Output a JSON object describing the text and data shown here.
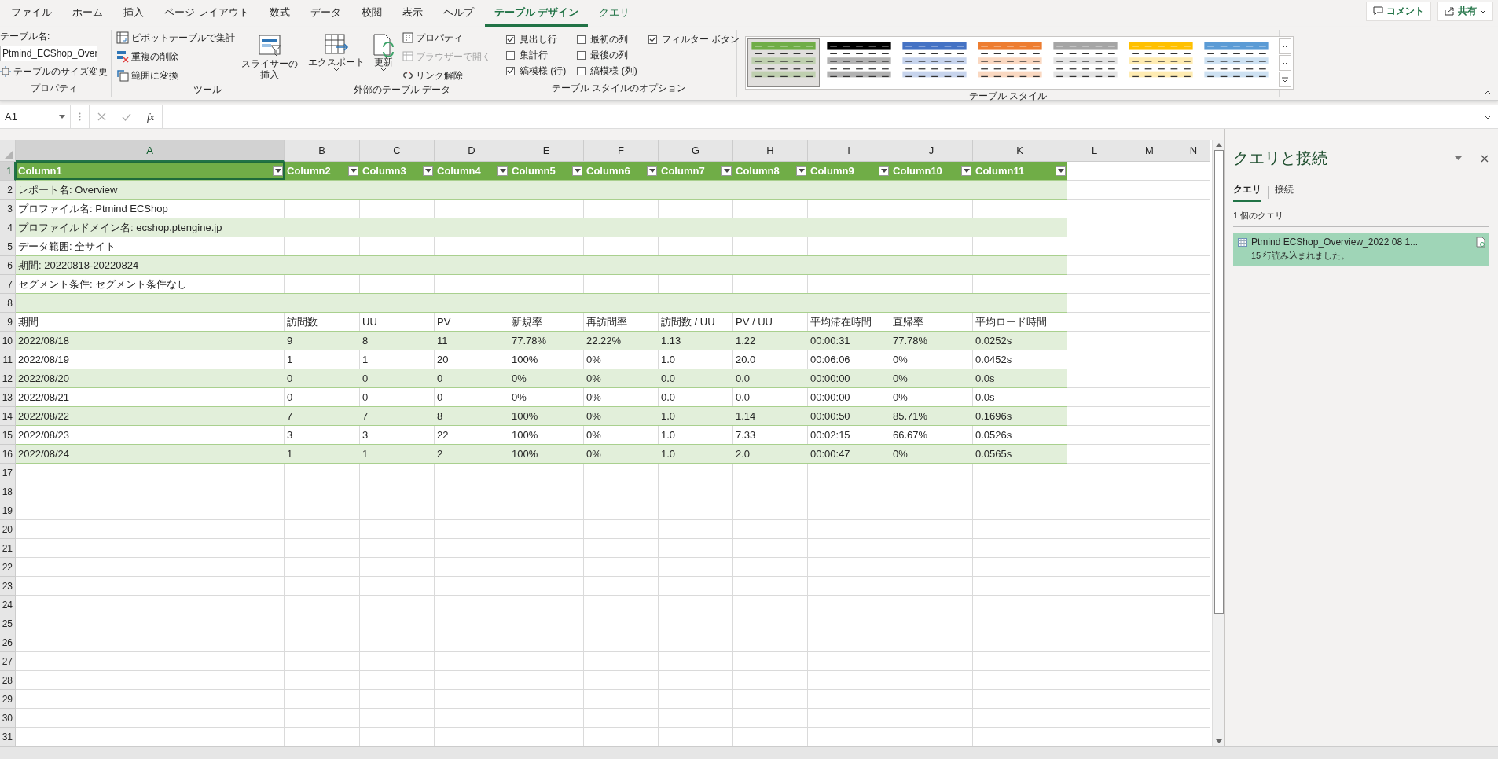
{
  "menu_tabs": [
    {
      "label": "ファイル",
      "selected": false,
      "contextual": false
    },
    {
      "label": "ホーム",
      "selected": false,
      "contextual": false
    },
    {
      "label": "挿入",
      "selected": false,
      "contextual": false
    },
    {
      "label": "ページ レイアウト",
      "selected": false,
      "contextual": false
    },
    {
      "label": "数式",
      "selected": false,
      "contextual": false
    },
    {
      "label": "データ",
      "selected": false,
      "contextual": false
    },
    {
      "label": "校閲",
      "selected": false,
      "contextual": false
    },
    {
      "label": "表示",
      "selected": false,
      "contextual": false
    },
    {
      "label": "ヘルプ",
      "selected": false,
      "contextual": false
    },
    {
      "label": "テーブル デザイン",
      "selected": true,
      "contextual": true
    },
    {
      "label": "クエリ",
      "selected": false,
      "contextual": true
    }
  ],
  "top_buttons": {
    "comment": "コメント",
    "share": "共有"
  },
  "ribbon": {
    "properties": {
      "label": "テーブル名:",
      "table_name": "Ptmind_ECShop_Over",
      "resize": "テーブルのサイズ変更",
      "group": "プロパティ"
    },
    "tools": {
      "pivot": "ピボットテーブルで集計",
      "remove_duplicates": "重複の削除",
      "convert": "範囲に変換",
      "slicer": [
        "スライサーの",
        "挿入"
      ],
      "group": "ツール"
    },
    "external": {
      "export": "エクスポート",
      "refresh": "更新",
      "properties": "プロパティ",
      "open_browser": "ブラウザーで開く",
      "open_browser_disabled": true,
      "unlink": "リンク解除",
      "group": "外部のテーブル データ"
    },
    "style_options": {
      "group": "テーブル スタイルのオプション",
      "checkboxes": [
        {
          "label": "見出し行",
          "checked": true
        },
        {
          "label": "集計行",
          "checked": false
        },
        {
          "label": "縞模様 (行)",
          "checked": true
        },
        {
          "label": "最初の列",
          "checked": false
        },
        {
          "label": "最後の列",
          "checked": false
        },
        {
          "label": "縞模様 (列)",
          "checked": false
        },
        {
          "label": "フィルター ボタン",
          "checked": true
        }
      ]
    },
    "table_styles": {
      "group": "テーブル スタイル",
      "styles": [
        {
          "color": "#70ad47",
          "selected": true
        },
        {
          "color": "#000000",
          "selected": false
        },
        {
          "color": "#4472c4",
          "selected": false
        },
        {
          "color": "#ed7d31",
          "selected": false
        },
        {
          "color": "#a5a5a5",
          "selected": false
        },
        {
          "color": "#ffc000",
          "selected": false
        },
        {
          "color": "#5b9bd5",
          "selected": false
        }
      ]
    }
  },
  "formula_bar": {
    "name_box": "A1",
    "function_button": "fx"
  },
  "grid": {
    "columns": [
      {
        "label": "A",
        "selected": true
      },
      {
        "label": "B",
        "selected": false
      },
      {
        "label": "C",
        "selected": false
      },
      {
        "label": "D",
        "selected": false
      },
      {
        "label": "E",
        "selected": false
      },
      {
        "label": "F",
        "selected": false
      },
      {
        "label": "G",
        "selected": false
      },
      {
        "label": "H",
        "selected": false
      },
      {
        "label": "I",
        "selected": false
      },
      {
        "label": "J",
        "selected": false
      },
      {
        "label": "K",
        "selected": false
      },
      {
        "label": "L",
        "selected": false
      },
      {
        "label": "M",
        "selected": false
      },
      {
        "label": "N",
        "selected": false
      }
    ],
    "table_rows": [
      {
        "number": "1",
        "selected": true,
        "cells": [
          "Column1",
          "Column2",
          "Column3",
          "Column4",
          "Column5",
          "Column6",
          "Column7",
          "Column8",
          "Column9",
          "Column10",
          "Column11"
        ]
      },
      {
        "number": "2",
        "selected": false,
        "cells": [
          "レポート名: Overview"
        ]
      },
      {
        "number": "3",
        "selected": false,
        "cells": [
          "プロファイル名: Ptmind ECShop"
        ]
      },
      {
        "number": "4",
        "selected": false,
        "cells": [
          "プロファイルドメイン名: ecshop.ptengine.jp"
        ]
      },
      {
        "number": "5",
        "selected": false,
        "cells": [
          "データ範囲: 全サイト"
        ]
      },
      {
        "number": "6",
        "selected": false,
        "cells": [
          "期間: 20220818-20220824"
        ]
      },
      {
        "number": "7",
        "selected": false,
        "cells": [
          "セグメント条件: セグメント条件なし"
        ]
      },
      {
        "number": "8",
        "selected": false
      },
      {
        "number": "9",
        "selected": false,
        "cells": [
          "期間",
          "訪問数",
          "UU",
          "PV",
          "新規率",
          "再訪問率",
          "訪問数 / UU",
          "PV / UU",
          "平均滞在時間",
          "直帰率",
          "平均ロード時間"
        ]
      },
      {
        "number": "10",
        "selected": false,
        "cells": [
          "2022/08/18",
          "9",
          "8",
          "11",
          "77.78%",
          "22.22%",
          "1.13",
          "1.22",
          "00:00:31",
          "77.78%",
          "0.0252s"
        ]
      },
      {
        "number": "11",
        "selected": false,
        "cells": [
          "2022/08/19",
          "1",
          "1",
          "20",
          "100%",
          "0%",
          "1.0",
          "20.0",
          "00:06:06",
          "0%",
          "0.0452s"
        ]
      },
      {
        "number": "12",
        "selected": false,
        "cells": [
          "2022/08/20",
          "0",
          "0",
          "0",
          "0%",
          "0%",
          "0.0",
          "0.0",
          "00:00:00",
          "0%",
          "0.0s"
        ]
      },
      {
        "number": "13",
        "selected": false,
        "cells": [
          "2022/08/21",
          "0",
          "0",
          "0",
          "0%",
          "0%",
          "0.0",
          "0.0",
          "00:00:00",
          "0%",
          "0.0s"
        ]
      },
      {
        "number": "14",
        "selected": false,
        "cells": [
          "2022/08/22",
          "7",
          "7",
          "8",
          "100%",
          "0%",
          "1.0",
          "1.14",
          "00:00:50",
          "85.71%",
          "0.1696s"
        ]
      },
      {
        "number": "15",
        "selected": false,
        "cells": [
          "2022/08/23",
          "3",
          "3",
          "22",
          "100%",
          "0%",
          "1.0",
          "7.33",
          "00:02:15",
          "66.67%",
          "0.0526s"
        ]
      },
      {
        "number": "16",
        "selected": false,
        "cells": [
          "2022/08/24",
          "1",
          "1",
          "2",
          "100%",
          "0%",
          "1.0",
          "2.0",
          "00:00:47",
          "0%",
          "0.0565s"
        ]
      }
    ],
    "empty_rows": [
      "17",
      "18",
      "19",
      "20",
      "21",
      "22",
      "23",
      "24",
      "25",
      "26",
      "27",
      "28",
      "29",
      "30",
      "31"
    ]
  },
  "query_panel": {
    "title": "クエリと接続",
    "tabs": [
      {
        "label": "クエリ",
        "selected": true
      },
      {
        "label": "接続",
        "selected": false
      }
    ],
    "count": "1 個のクエリ",
    "queries": [
      {
        "name": "Ptmind ECShop_Overview_2022 08 1...",
        "status": "15 行読み込まれました。",
        "selected": true
      }
    ]
  }
}
